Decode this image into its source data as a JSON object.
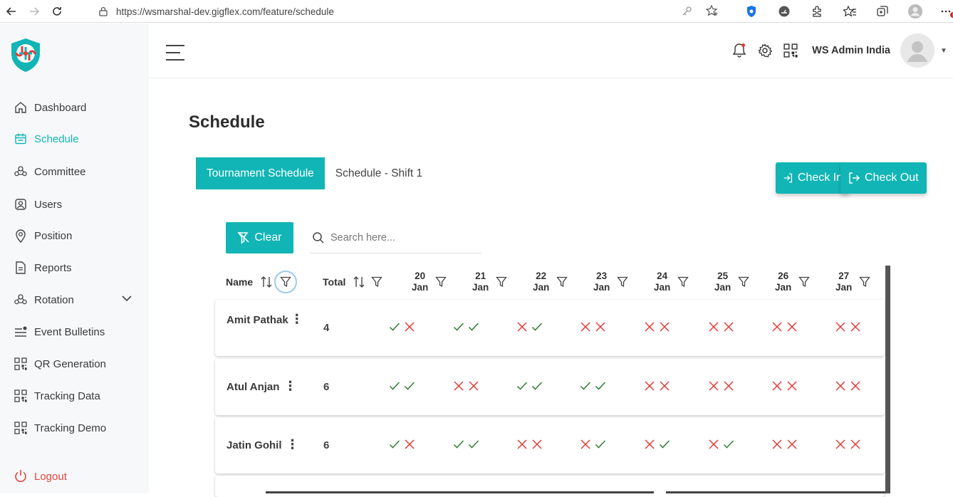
{
  "browser": {
    "url": "https://wsmarshal-dev.gigflex.com/feature/schedule"
  },
  "sidebar": {
    "items": [
      {
        "label": "Dashboard",
        "icon": "home-icon",
        "active": false
      },
      {
        "label": "Schedule",
        "icon": "calendar-icon",
        "active": true
      },
      {
        "label": "Committee",
        "icon": "committee-icon",
        "active": false
      },
      {
        "label": "Users",
        "icon": "user-icon",
        "active": false
      },
      {
        "label": "Position",
        "icon": "location-pin-icon",
        "active": false
      },
      {
        "label": "Reports",
        "icon": "report-icon",
        "active": false
      },
      {
        "label": "Rotation",
        "icon": "rotation-icon",
        "active": false,
        "expandable": true
      },
      {
        "label": "Event Bulletins",
        "icon": "bulletin-icon",
        "active": false
      },
      {
        "label": "QR Generation",
        "icon": "qr-icon",
        "active": false
      },
      {
        "label": "Tracking Data",
        "icon": "qr-icon",
        "active": false
      },
      {
        "label": "Tracking Demo",
        "icon": "qr-icon",
        "active": false
      }
    ],
    "logout": "Logout"
  },
  "header": {
    "user_name": "WS Admin India"
  },
  "page": {
    "title": "Schedule",
    "tabs": [
      "Tournament Schedule",
      "Schedule - Shift 1"
    ],
    "check_in": "Check In",
    "check_out": "Check Out",
    "clear": "Clear",
    "search_placeholder": "Search here..."
  },
  "table": {
    "col_name": "Name",
    "col_total": "Total",
    "dates": [
      {
        "day": "20",
        "month": "Jan"
      },
      {
        "day": "21",
        "month": "Jan"
      },
      {
        "day": "22",
        "month": "Jan"
      },
      {
        "day": "23",
        "month": "Jan"
      },
      {
        "day": "24",
        "month": "Jan"
      },
      {
        "day": "25",
        "month": "Jan"
      },
      {
        "day": "26",
        "month": "Jan"
      },
      {
        "day": "27",
        "month": "Jan"
      }
    ],
    "rows": [
      {
        "name": "Amit Pathak",
        "total": "4",
        "marks": [
          [
            "y",
            "n"
          ],
          [
            "y",
            "y"
          ],
          [
            "n",
            "y"
          ],
          [
            "n",
            "n"
          ],
          [
            "n",
            "n"
          ],
          [
            "n",
            "n"
          ],
          [
            "n",
            "n"
          ],
          [
            "n",
            "n"
          ]
        ]
      },
      {
        "name": "Atul Anjan",
        "total": "6",
        "marks": [
          [
            "y",
            "y"
          ],
          [
            "n",
            "n"
          ],
          [
            "y",
            "y"
          ],
          [
            "y",
            "y"
          ],
          [
            "n",
            "n"
          ],
          [
            "n",
            "n"
          ],
          [
            "n",
            "n"
          ],
          [
            "n",
            "n"
          ]
        ]
      },
      {
        "name": "Jatin Gohil",
        "total": "6",
        "marks": [
          [
            "y",
            "n"
          ],
          [
            "y",
            "y"
          ],
          [
            "n",
            "n"
          ],
          [
            "n",
            "y"
          ],
          [
            "n",
            "y"
          ],
          [
            "n",
            "y"
          ],
          [
            "n",
            "n"
          ],
          [
            "n",
            "n"
          ]
        ]
      }
    ]
  },
  "colors": {
    "accent": "#12b5b5",
    "check": "#2e7d32",
    "cross": "#e53935",
    "logout": "#e0453a"
  }
}
